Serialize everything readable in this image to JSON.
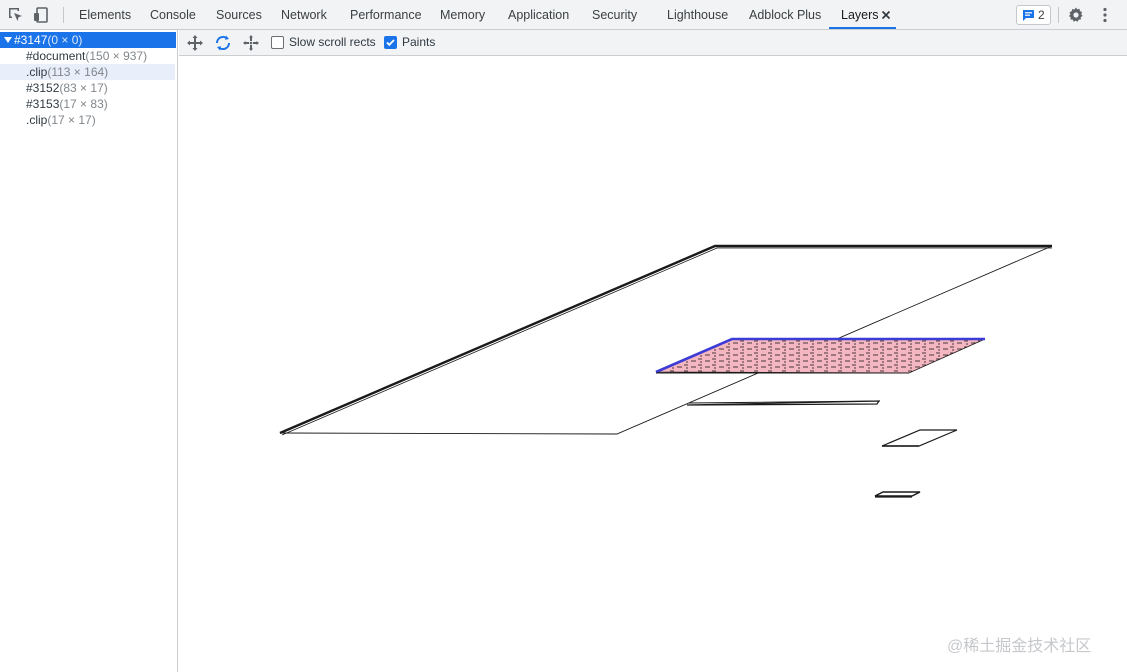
{
  "tabs": [
    {
      "label": "Elements"
    },
    {
      "label": "Console"
    },
    {
      "label": "Sources"
    },
    {
      "label": "Network"
    },
    {
      "label": "Performance"
    },
    {
      "label": "Memory"
    },
    {
      "label": "Application"
    },
    {
      "label": "Security"
    },
    {
      "label": "Lighthouse"
    },
    {
      "label": "Adblock Plus"
    },
    {
      "label": "Layers"
    }
  ],
  "active_tab": "Layers",
  "issues": {
    "count": "2"
  },
  "layers_toolbar": {
    "slow_scroll_label": "Slow scroll rects",
    "slow_scroll_checked": false,
    "paints_label": "Paints",
    "paints_checked": true
  },
  "layer_tree": [
    {
      "name": "#3147",
      "size": "(0 × 0)"
    },
    {
      "name": "#document",
      "size": "(150 × 937)"
    },
    {
      "name": ".clip",
      "size": "(113 × 164)"
    },
    {
      "name": "#3152",
      "size": "(83 × 17)"
    },
    {
      "name": "#3153",
      "size": "(17 × 83)"
    },
    {
      "name": ".clip",
      "size": "(17 × 17)"
    }
  ],
  "colors": {
    "accent": "#1a73e8",
    "paint_fill": "#f4b6c0",
    "layer_edge_selected": "#3b3bd6"
  },
  "watermark": "@稀土掘金技术社区"
}
